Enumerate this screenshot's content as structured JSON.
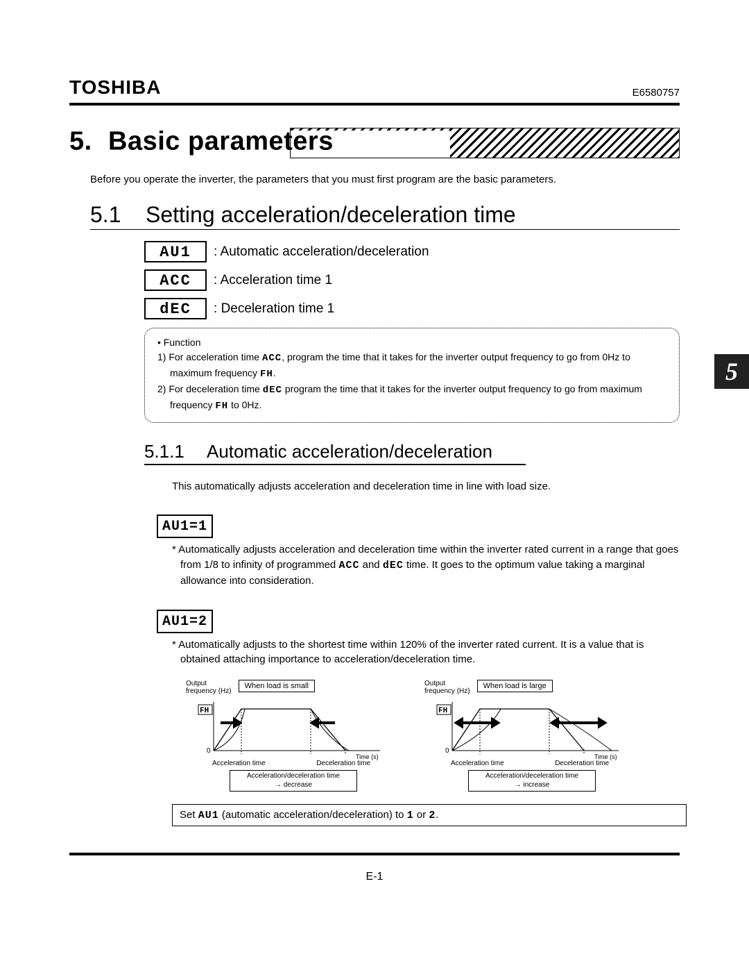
{
  "brand": "TOSHIBA",
  "docnum": "E6580757",
  "chapter": {
    "num": "5.",
    "title": "Basic parameters",
    "tab": "5"
  },
  "intro": "Before you operate the inverter, the parameters that you must first program are the basic parameters.",
  "h51": {
    "num": "5.1",
    "title": "Setting acceleration/deceleration time"
  },
  "params": [
    {
      "code": "AU1",
      "desc": "Automatic acceleration/deceleration"
    },
    {
      "code": "ACC",
      "desc": "Acceleration time 1"
    },
    {
      "code": "dEC",
      "desc": "Deceleration time 1"
    }
  ],
  "func": {
    "heading": "Function",
    "item1a": "1) For acceleration time ",
    "item1b": ", program the time that it takes for the inverter output frequency to go from 0Hz to maximum frequency ",
    "item1c": ".",
    "item2a": "2) For deceleration time ",
    "item2b": " program the time that it takes for the inverter output frequency to go from maximum frequency ",
    "item2c": " to 0Hz.",
    "seg_acc": "ACC",
    "seg_dec": "dEC",
    "seg_fh": "FH"
  },
  "h511": {
    "num": "5.1.1",
    "title": "Automatic acceleration/deceleration"
  },
  "p511": "This automatically adjusts acceleration and deceleration time in line with load size.",
  "set1": "AU1=1",
  "star1a": "*  Automatically adjusts acceleration and deceleration time within the inverter rated current in a range that goes from 1/8 to infinity of programmed ",
  "star1b": " and ",
  "star1c": " time. It goes to the optimum value taking a marginal allowance into consideration.",
  "set2": "AU1=2",
  "star2": "*  Automatically adjusts to the shortest time within 120% of the inverter rated current. It is a value that is obtained attaching importance to acceleration/deceleration time.",
  "dg": {
    "ylabel": "Output\nfrequency (Hz)",
    "fh": "FH",
    "zero": "0",
    "xlabel": "Time (s)",
    "accel": "Acceleration time",
    "decel": "Deceleration time",
    "small_title": "When load is small",
    "small_box": "Acceleration/deceleration time\n→ decrease",
    "large_title": "When load is large",
    "large_box": "Acceleration/deceleration time\n→ increase"
  },
  "instr": {
    "a": "Set ",
    "seg": "AU1",
    "b": " (automatic acceleration/deceleration) to ",
    "v1": "1",
    "c": " or ",
    "v2": "2",
    "d": "."
  },
  "pagenum": "E-1",
  "chart_data": [
    {
      "type": "line",
      "title": "When load is small",
      "xlabel": "Time (s)",
      "ylabel": "Output frequency (Hz)",
      "x": [
        0,
        1,
        3,
        4
      ],
      "y": [
        0,
        1,
        1,
        0
      ],
      "annotations": [
        "Acceleration time",
        "Deceleration time",
        "FH",
        "Acceleration/deceleration time → decrease"
      ]
    },
    {
      "type": "line",
      "title": "When load is large",
      "xlabel": "Time (s)",
      "ylabel": "Output frequency (Hz)",
      "x": [
        0,
        1.5,
        3,
        4.5
      ],
      "y": [
        0,
        1,
        1,
        0
      ],
      "annotations": [
        "Acceleration time",
        "Deceleration time",
        "FH",
        "Acceleration/deceleration time → increase"
      ]
    }
  ]
}
